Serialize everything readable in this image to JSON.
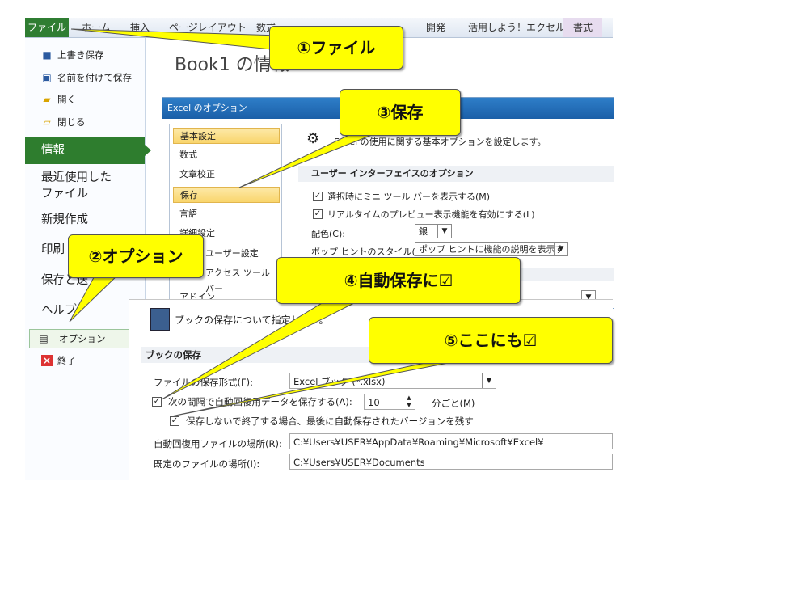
{
  "ribbon": {
    "tabs": [
      "ファイル",
      "ホーム",
      "挿入",
      "ページレイアウト",
      "数式",
      "開発",
      "活用しよう！エクセル",
      "書式"
    ]
  },
  "backstage": {
    "save": "上書き保存",
    "save_as": "名前を付けて保存",
    "open": "開く",
    "close": "閉じる",
    "info": "情報",
    "recent": "最近使用した\nファイル",
    "new": "新規作成",
    "print": "印刷",
    "save_send": "保存と送",
    "help": "ヘルプ",
    "options": "オプション",
    "exit": "終了"
  },
  "main": {
    "title": "Book1 の情報"
  },
  "options_dialog": {
    "title": "Excel のオプション",
    "nav": [
      "基本設定",
      "数式",
      "文章校正",
      "保存",
      "言語",
      "詳細設定",
      "ユーザー設定",
      "アクセス ツール バー",
      "アドイン"
    ],
    "intro": "Excel の使用に関する基本オプションを設定します。",
    "ui_section": "ユーザー インターフェイスのオプション",
    "opt_minitoolbar": "選択時にミニ ツール バーを表示する(M)",
    "opt_livepreview": "リアルタイムのプレビュー表示機能を有効にする(L)",
    "color_label": "配色(C):",
    "color_value": "銀",
    "tooltip_label": "ポップ ヒントのスタイル(R):",
    "tooltip_value": "ポップ ヒントに機能の説明を表示する"
  },
  "save_panel": {
    "header": "ブックの保存について指定します。",
    "section": "ブックの保存",
    "format_label": "ファイルの保存形式(F):",
    "format_value": "Excel ブック (*.xlsx)",
    "autosave_label": "次の間隔で自動回復用データを保存する(A):",
    "autosave_minutes": "10",
    "minutes_unit": "分ごと(M)",
    "keep_last_label": "保存しないで終了する場合、最後に自動保存されたバージョンを残す",
    "autorecover_label": "自動回復用ファイルの場所(R):",
    "autorecover_value": "C:¥Users¥USER¥AppData¥Roaming¥Microsoft¥Excel¥",
    "default_label": "既定のファイルの場所(I):",
    "default_value": "C:¥Users¥USER¥Documents"
  },
  "callouts": {
    "c1": "①ファイル",
    "c2": "②オプション",
    "c3": "③保存",
    "c4": "④自動保存に☑",
    "c5": "⑤ここにも☑"
  },
  "colors": {
    "callout": "#ffff00",
    "file_tab": "#2f7d32",
    "dialog_title": "#1b5fa8"
  }
}
